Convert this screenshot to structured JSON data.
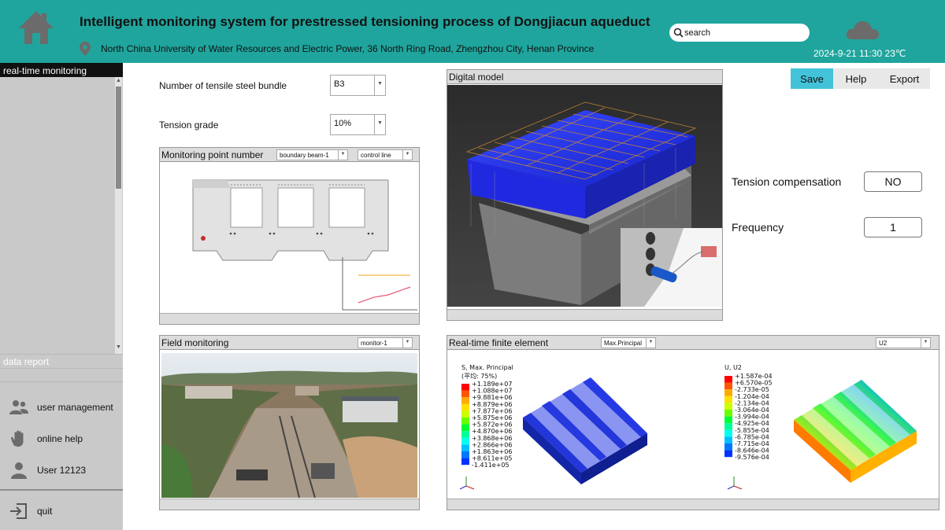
{
  "header": {
    "title": "Intelligent monitoring system for prestressed tensioning process of Dongjiacun aqueduct",
    "address": "North China University of Water Resources and Electric Power, 36 North Ring Road, Zhengzhou City, Henan Province",
    "search_placeholder": "search",
    "datetime": "2024-9-21 11:30 23℃",
    "weather_icon": "cloud-icon"
  },
  "sidebar": {
    "active_item": "real-time monitoring",
    "data_report": "data report",
    "menu": [
      {
        "label": "user management",
        "icon": "users-icon"
      },
      {
        "label": "online help",
        "icon": "hand-icon"
      },
      {
        "label": "User 12123",
        "icon": "user-icon"
      },
      {
        "label": "quit",
        "icon": "logout-icon"
      }
    ]
  },
  "form": {
    "bundle_label": "Number of tensile steel bundle",
    "bundle_value": "B3",
    "grade_label": "Tension grade",
    "grade_value": "10%"
  },
  "monitoring_point": {
    "title": "Monitoring point number",
    "select1": "boundary beam-1",
    "select2": "control line"
  },
  "field_monitoring": {
    "title": "Field monitoring",
    "select": "monitor-1"
  },
  "digital_model": {
    "title": "Digital model"
  },
  "finite_element": {
    "title": "Real-time finite element",
    "select1": "Max.Principal",
    "select2": "U2",
    "left_legend": {
      "title": "S, Max. Principal",
      "subtitle": "(平均: 75%)",
      "values": [
        "+1.189e+07",
        "+1.088e+07",
        "+9.881e+06",
        "+8.879e+06",
        "+7.877e+06",
        "+5.875e+06",
        "+5.872e+06",
        "+4.870e+06",
        "+3.868e+06",
        "+2.866e+06",
        "+1.863e+06",
        "+8.611e+05",
        "-1.411e+05"
      ]
    },
    "right_legend": {
      "title": "U, U2",
      "values": [
        "+1.587e-04",
        "+6.570e-05",
        "-2.733e-05",
        "-1.204e-04",
        "-2.134e-04",
        "-3.064e-04",
        "-3.994e-04",
        "-4.925e-04",
        "-5.855e-04",
        "-6.785e-04",
        "-7.715e-04",
        "-8.646e-04",
        "-9.576e-04"
      ]
    },
    "legend_colors": [
      "#ff0000",
      "#ff5500",
      "#ffaa00",
      "#ffe000",
      "#ccff00",
      "#66ff00",
      "#00ff33",
      "#00ff99",
      "#00ffee",
      "#00c0ff",
      "#0077ff",
      "#0033ff",
      "#0000cc"
    ]
  },
  "actions": {
    "save": "Save",
    "help": "Help",
    "export": "Export"
  },
  "settings": {
    "compensation_label": "Tension compensation",
    "compensation_value": "NO",
    "frequency_label": "Frequency",
    "frequency_value": "1"
  },
  "colors": {
    "header": "#1fa59d",
    "save_active": "#42c3d9",
    "sidebar": "#c9c9c9"
  }
}
